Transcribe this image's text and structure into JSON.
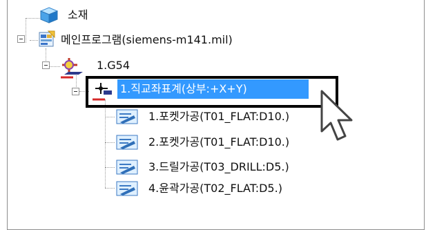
{
  "tree": {
    "root_material": {
      "label": "소재",
      "icon": "cube-icon"
    },
    "main_program": {
      "label": "메인프로그램(siemens-m141.mil)",
      "icon": "program-icon"
    },
    "coordinate": {
      "label": "1.G54",
      "icon": "coordinate-system-icon"
    },
    "selected_setup": {
      "label": "1.직교좌표계(상부:+X+Y)",
      "icon": "axis-setup-icon"
    },
    "operations": [
      {
        "label": "1.포켓가공(T01_FLAT:D10.)",
        "icon": "operation-icon"
      },
      {
        "label": "2.포켓가공(T01_FLAT:D10.)",
        "icon": "operation-icon"
      },
      {
        "label": "3.드릴가공(T03_DRILL:D5.)",
        "icon": "operation-icon"
      },
      {
        "label": "4.윤곽가공(T02_FLAT:D5.)",
        "icon": "operation-icon"
      }
    ]
  },
  "colors": {
    "selection": "#3399ff",
    "highlight_border": "#000000"
  },
  "pointer": {
    "icon": "mouse-cursor-icon"
  }
}
